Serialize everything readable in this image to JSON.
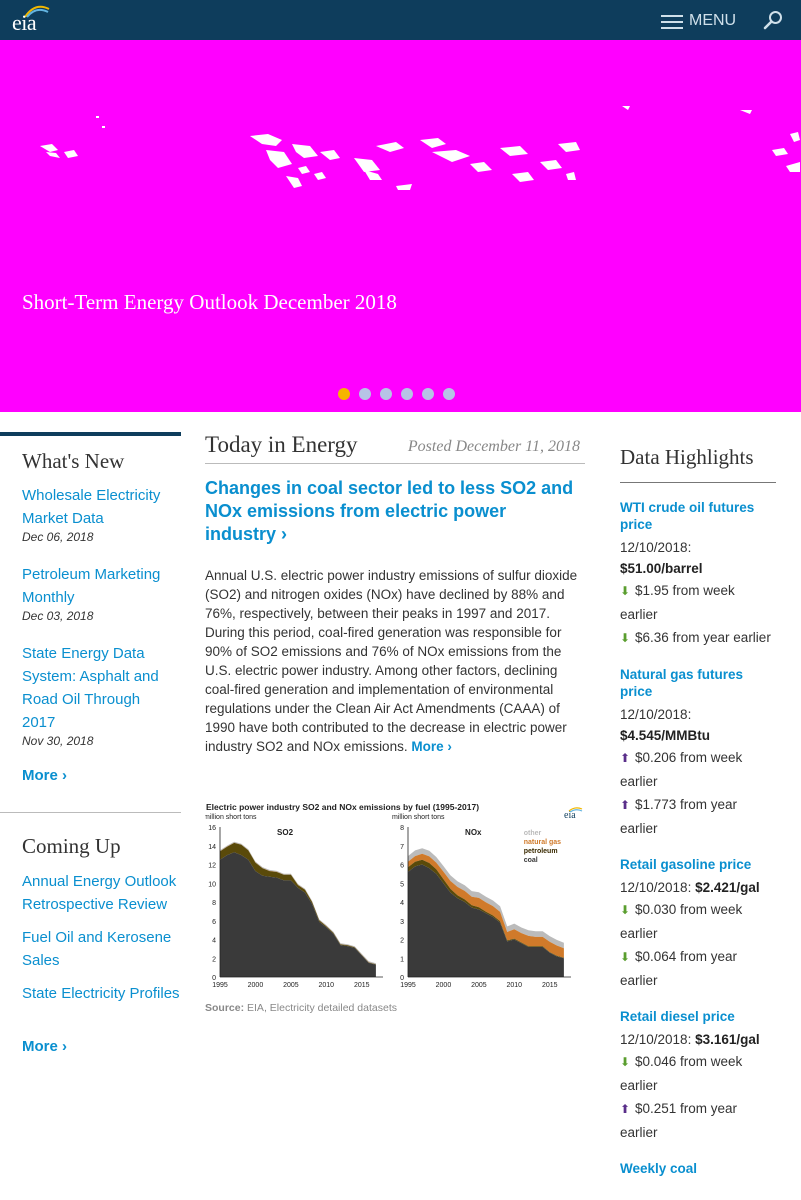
{
  "header": {
    "logo_text": "eia",
    "menu_label": "MENU"
  },
  "hero": {
    "caption": "Short-Term Energy Outlook December 2018",
    "slide_count": 6,
    "active_slide": 1
  },
  "whats_new": {
    "title": "What's New",
    "items": [
      {
        "label": "Wholesale Electricity Market Data",
        "date": "Dec 06, 2018"
      },
      {
        "label": "Petroleum Marketing Monthly",
        "date": "Dec 03, 2018"
      },
      {
        "label": "State Energy Data System: Asphalt and Road Oil Through 2017",
        "date": "Nov 30, 2018"
      }
    ],
    "more_label": "More ›"
  },
  "coming_up": {
    "title": "Coming Up",
    "items": [
      {
        "label": "Annual Energy Outlook Retrospective Review"
      },
      {
        "label": "Fuel Oil and Kerosene Sales"
      },
      {
        "label": "State Electricity Profiles"
      }
    ],
    "more_label": "More ›"
  },
  "today": {
    "title": "Today in Energy",
    "posted": "Posted December 11, 2018",
    "headline": "Changes in coal sector led to less SO2 and NOx emissions from electric power industry ›",
    "body": "Annual U.S. electric power industry emissions of sulfur dioxide (SO2) and nitrogen oxides (NOx) have declined by 88% and 76%, respectively, between their peaks in 1997 and 2017. During this period, coal-fired generation was responsible for 90% of SO2 emissions and 76% of NOx emissions from the U.S. electric power industry. Among other factors, declining coal-fired generation and implementation of environmental regulations under the Clean Air Act Amendments (CAAA) of 1990 have both contributed to the decrease in electric power industry SO2 and NOx emissions.",
    "more_label": "More ›",
    "chart_title": "Electric power industry SO2 and NOx emissions by fuel (1995-2017)",
    "chart_source_label": "Source:",
    "chart_source": "EIA, Electricity detailed datasets"
  },
  "chart_data": [
    {
      "type": "area",
      "title": "SO2",
      "ylabel": "million short tons",
      "x": [
        1995,
        1996,
        1997,
        1998,
        1999,
        2000,
        2001,
        2002,
        2003,
        2004,
        2005,
        2006,
        2007,
        2008,
        2009,
        2010,
        2011,
        2012,
        2013,
        2014,
        2015,
        2016,
        2017
      ],
      "xticks": [
        1995,
        2000,
        2005,
        2010,
        2015
      ],
      "ylim": [
        0,
        16
      ],
      "yticks": [
        0,
        2,
        4,
        6,
        8,
        10,
        12,
        14,
        16
      ],
      "series": [
        {
          "name": "coal",
          "values": [
            12.5,
            13.0,
            13.3,
            13.0,
            12.5,
            11.3,
            10.8,
            10.7,
            10.6,
            10.3,
            10.3,
            9.5,
            9.0,
            7.8,
            5.9,
            5.3,
            4.6,
            3.4,
            3.3,
            3.1,
            2.3,
            1.5,
            1.3
          ]
        },
        {
          "name": "petroleum",
          "values": [
            0.9,
            0.9,
            1.0,
            1.1,
            1.0,
            0.9,
            0.8,
            0.6,
            0.6,
            0.6,
            0.6,
            0.3,
            0.3,
            0.2,
            0.15,
            0.12,
            0.1,
            0.08,
            0.08,
            0.07,
            0.06,
            0.05,
            0.05
          ]
        },
        {
          "name": "natural gas",
          "values": [
            0.02,
            0.02,
            0.02,
            0.02,
            0.02,
            0.02,
            0.02,
            0.02,
            0.02,
            0.02,
            0.02,
            0.02,
            0.02,
            0.02,
            0.02,
            0.02,
            0.02,
            0.02,
            0.02,
            0.02,
            0.02,
            0.02,
            0.02
          ]
        },
        {
          "name": "other",
          "values": [
            0.1,
            0.1,
            0.1,
            0.1,
            0.1,
            0.1,
            0.1,
            0.1,
            0.1,
            0.1,
            0.1,
            0.1,
            0.1,
            0.1,
            0.1,
            0.1,
            0.1,
            0.1,
            0.1,
            0.1,
            0.1,
            0.1,
            0.1
          ]
        }
      ]
    },
    {
      "type": "area",
      "title": "NOx",
      "ylabel": "million short tons",
      "x": [
        1995,
        1996,
        1997,
        1998,
        1999,
        2000,
        2001,
        2002,
        2003,
        2004,
        2005,
        2006,
        2007,
        2008,
        2009,
        2010,
        2011,
        2012,
        2013,
        2014,
        2015,
        2016,
        2017
      ],
      "xticks": [
        1995,
        2000,
        2005,
        2010,
        2015
      ],
      "ylim": [
        0,
        8
      ],
      "yticks": [
        0,
        1,
        2,
        3,
        4,
        5,
        6,
        7,
        8
      ],
      "legend": [
        "other",
        "natural gas",
        "petroleum",
        "coal"
      ],
      "series": [
        {
          "name": "coal",
          "values": [
            5.6,
            5.9,
            6.0,
            5.8,
            5.5,
            5.0,
            4.5,
            4.2,
            4.0,
            3.7,
            3.6,
            3.4,
            3.2,
            2.9,
            1.9,
            2.0,
            1.8,
            1.6,
            1.6,
            1.6,
            1.3,
            1.1,
            1.0
          ]
        },
        {
          "name": "petroleum",
          "values": [
            0.25,
            0.25,
            0.25,
            0.28,
            0.25,
            0.22,
            0.2,
            0.15,
            0.14,
            0.13,
            0.12,
            0.08,
            0.08,
            0.07,
            0.05,
            0.05,
            0.04,
            0.04,
            0.04,
            0.04,
            0.03,
            0.03,
            0.03
          ]
        },
        {
          "name": "natural gas",
          "values": [
            0.3,
            0.3,
            0.32,
            0.35,
            0.35,
            0.4,
            0.42,
            0.45,
            0.45,
            0.45,
            0.5,
            0.5,
            0.5,
            0.5,
            0.45,
            0.5,
            0.5,
            0.55,
            0.5,
            0.5,
            0.55,
            0.55,
            0.5
          ]
        },
        {
          "name": "other",
          "values": [
            0.3,
            0.3,
            0.3,
            0.3,
            0.3,
            0.3,
            0.3,
            0.3,
            0.3,
            0.3,
            0.3,
            0.3,
            0.3,
            0.3,
            0.3,
            0.3,
            0.3,
            0.3,
            0.3,
            0.3,
            0.3,
            0.3,
            0.3
          ]
        }
      ]
    }
  ],
  "chart_colors": {
    "coal": "#3a3a3a",
    "petroleum": "#5a4a0a",
    "natural gas": "#d07a2a",
    "other": "#bbbbbb"
  },
  "data_highlights": {
    "title": "Data Highlights",
    "items": [
      {
        "title": "WTI crude oil futures price",
        "date_line": "12/10/2018:",
        "value": "$51.00/barrel",
        "changes": [
          {
            "direction": "down",
            "text": "$1.95 from week earlier"
          },
          {
            "direction": "down",
            "text": "$6.36 from year earlier"
          }
        ]
      },
      {
        "title": "Natural gas futures price",
        "date_line": "12/10/2018:",
        "value": "$4.545/MMBtu",
        "changes": [
          {
            "direction": "up",
            "text": "$0.206 from week earlier"
          },
          {
            "direction": "up",
            "text": "$1.773 from year earlier"
          }
        ]
      },
      {
        "title": "Retail gasoline price",
        "date_line": "12/10/2018:",
        "value": "$2.421/gal",
        "changes": [
          {
            "direction": "down",
            "text": "$0.030 from week earlier"
          },
          {
            "direction": "down",
            "text": "$0.064 from year earlier"
          }
        ]
      },
      {
        "title": "Retail diesel price",
        "date_line": "12/10/2018:",
        "value": "$3.161/gal",
        "changes": [
          {
            "direction": "down",
            "text": "$0.046 from week earlier"
          },
          {
            "direction": "up",
            "text": "$0.251 from year earlier"
          }
        ]
      },
      {
        "title": "Weekly coal",
        "date_line": "",
        "value": "",
        "changes": []
      }
    ]
  }
}
